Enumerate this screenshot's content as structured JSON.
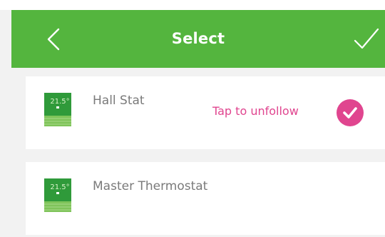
{
  "header": {
    "title": "Select",
    "back_icon": "chevron-left-icon",
    "done_icon": "checkmark-icon",
    "background": "#54b53e"
  },
  "devices": [
    {
      "name": "Hall Stat",
      "icon": "thermostat-icon",
      "icon_reading": "21.5°",
      "followed": true,
      "unfollow_label": "Tap to unfollow",
      "check_icon": "check-circle-icon"
    },
    {
      "name": "Master Thermostat",
      "icon": "thermostat-icon",
      "icon_reading": "21.5°",
      "followed": false
    }
  ],
  "colors": {
    "accent_pink": "#e0458f",
    "text_gray": "#7a7a7a",
    "list_background": "#f2f2f2"
  }
}
